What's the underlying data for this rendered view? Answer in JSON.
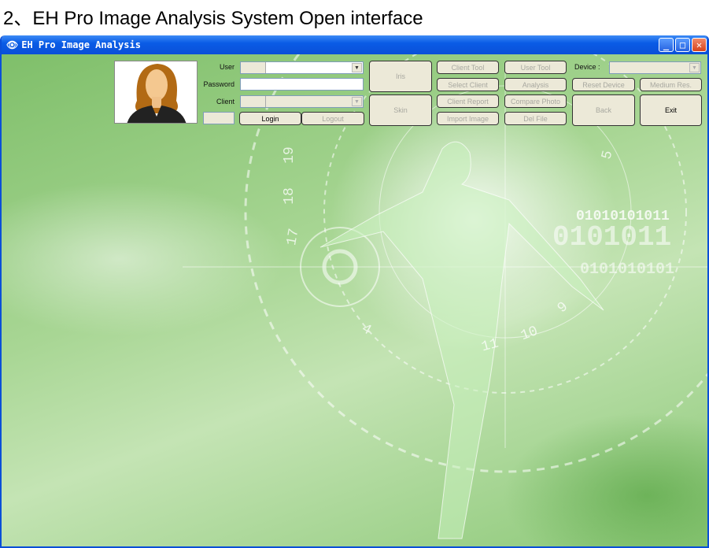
{
  "caption": "2、EH Pro Image Analysis System Open interface",
  "window": {
    "title": "EH Pro Image Analysis",
    "minimize": "_",
    "maximize": "□",
    "close": "✕"
  },
  "login": {
    "user_label": "User",
    "password_label": "Password",
    "client_label": "Client",
    "login": "Login",
    "logout": "Logout",
    "user_value": "",
    "password_value": "",
    "client_value": ""
  },
  "buttons": {
    "iris": "Iris",
    "skin": "Skin",
    "client_tool": "Client Tool",
    "select_client": "Select Client",
    "client_report": "Client Report",
    "import_image": "Import Image",
    "user_tool": "User Tool",
    "analysis": "Analysis",
    "compare_photo": "Compare Photo",
    "del_file": "Del File",
    "reset_device": "Reset Device",
    "medium_res": "Medium Res.",
    "back": "Back",
    "exit": "Exit"
  },
  "device": {
    "label": "Device :",
    "value": ""
  },
  "background": {
    "dial_numbers": [
      "19",
      "18",
      "17",
      "4",
      "10",
      "11",
      "9",
      "5"
    ],
    "binary": [
      "01010101011",
      "0101011",
      "0101010101"
    ]
  }
}
